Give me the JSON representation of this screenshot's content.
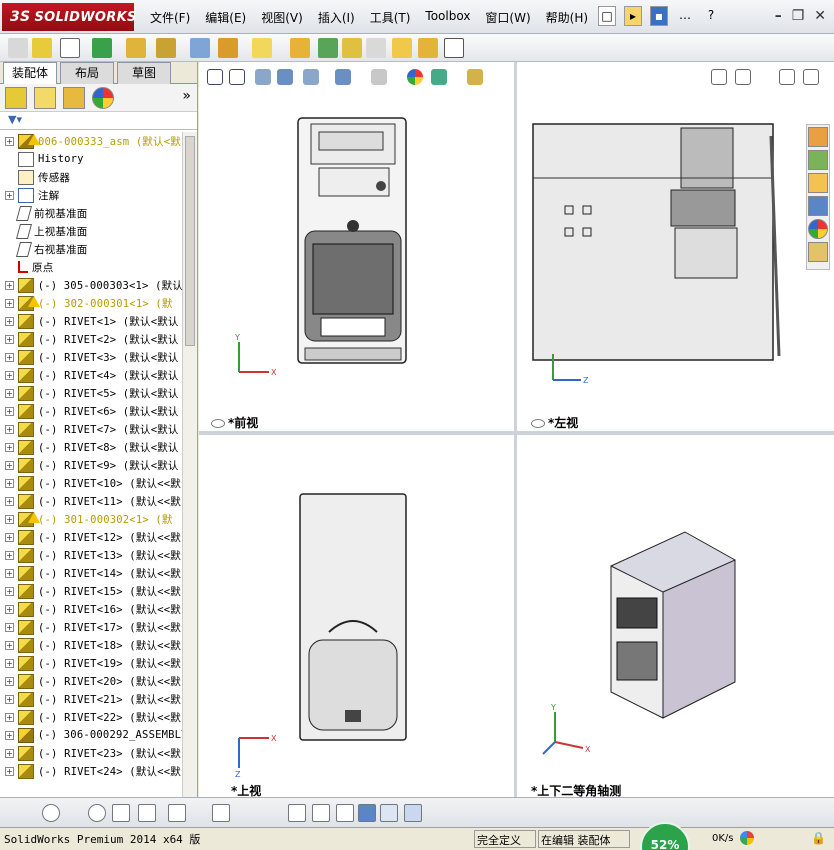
{
  "app": {
    "logo_ds": "3S",
    "logo_text": "SOLIDWORKS",
    "menu": [
      "文件(F)",
      "编辑(E)",
      "视图(V)",
      "插入(I)",
      "工具(T)",
      "Toolbox",
      "窗口(W)",
      "帮助(H)"
    ]
  },
  "panel": {
    "tabs": [
      "装配体",
      "布局",
      "草图"
    ],
    "expand_glyph": "»",
    "tree": [
      {
        "label": "006-000333_asm  (默认<默",
        "icon": "asm-warn",
        "exp": "+",
        "style": "warn"
      },
      {
        "label": "History",
        "icon": "hist",
        "exp": "",
        "style": "ok"
      },
      {
        "label": "传感器",
        "icon": "sens",
        "exp": "",
        "style": "ok"
      },
      {
        "label": "注解",
        "icon": "note",
        "exp": "+",
        "style": "ok"
      },
      {
        "label": "前视基准面",
        "icon": "plane",
        "exp": "",
        "style": "ok"
      },
      {
        "label": "上视基准面",
        "icon": "plane",
        "exp": "",
        "style": "ok"
      },
      {
        "label": "右视基准面",
        "icon": "plane",
        "exp": "",
        "style": "ok"
      },
      {
        "label": "原点",
        "icon": "origin",
        "exp": "",
        "style": "ok"
      },
      {
        "label": "(-) 305-000303<1> (默认",
        "icon": "part",
        "exp": "+",
        "style": "ok"
      },
      {
        "label": "(-) 302-000301<1> (默",
        "icon": "part-warn",
        "exp": "+",
        "style": "warn"
      },
      {
        "label": "(-) RIVET<1> (默认<默认",
        "icon": "part",
        "exp": "+",
        "style": "ok"
      },
      {
        "label": "(-) RIVET<2> (默认<默认",
        "icon": "part",
        "exp": "+",
        "style": "ok"
      },
      {
        "label": "(-) RIVET<3> (默认<默认",
        "icon": "part",
        "exp": "+",
        "style": "ok"
      },
      {
        "label": "(-) RIVET<4> (默认<默认",
        "icon": "part",
        "exp": "+",
        "style": "ok"
      },
      {
        "label": "(-) RIVET<5> (默认<默认",
        "icon": "part",
        "exp": "+",
        "style": "ok"
      },
      {
        "label": "(-) RIVET<6> (默认<默认",
        "icon": "part",
        "exp": "+",
        "style": "ok"
      },
      {
        "label": "(-) RIVET<7> (默认<默认",
        "icon": "part",
        "exp": "+",
        "style": "ok"
      },
      {
        "label": "(-) RIVET<8> (默认<默认",
        "icon": "part",
        "exp": "+",
        "style": "ok"
      },
      {
        "label": "(-) RIVET<9> (默认<默认",
        "icon": "part",
        "exp": "+",
        "style": "ok"
      },
      {
        "label": "(-) RIVET<10> (默认<<默",
        "icon": "part",
        "exp": "+",
        "style": "ok"
      },
      {
        "label": "(-) RIVET<11> (默认<<默",
        "icon": "part",
        "exp": "+",
        "style": "ok"
      },
      {
        "label": "(-) 301-000302<1> (默",
        "icon": "part-warn",
        "exp": "+",
        "style": "warn"
      },
      {
        "label": "(-) RIVET<12> (默认<<默",
        "icon": "part",
        "exp": "+",
        "style": "ok"
      },
      {
        "label": "(-) RIVET<13> (默认<<默",
        "icon": "part",
        "exp": "+",
        "style": "ok"
      },
      {
        "label": "(-) RIVET<14> (默认<<默",
        "icon": "part",
        "exp": "+",
        "style": "ok"
      },
      {
        "label": "(-) RIVET<15> (默认<<默",
        "icon": "part",
        "exp": "+",
        "style": "ok"
      },
      {
        "label": "(-) RIVET<16> (默认<<默",
        "icon": "part",
        "exp": "+",
        "style": "ok"
      },
      {
        "label": "(-) RIVET<17> (默认<<默",
        "icon": "part",
        "exp": "+",
        "style": "ok"
      },
      {
        "label": "(-) RIVET<18> (默认<<默",
        "icon": "part",
        "exp": "+",
        "style": "ok"
      },
      {
        "label": "(-) RIVET<19> (默认<<默",
        "icon": "part",
        "exp": "+",
        "style": "ok"
      },
      {
        "label": "(-) RIVET<20> (默认<<默",
        "icon": "part",
        "exp": "+",
        "style": "ok"
      },
      {
        "label": "(-) RIVET<21> (默认<<默",
        "icon": "part",
        "exp": "+",
        "style": "ok"
      },
      {
        "label": "(-) RIVET<22> (默认<<默",
        "icon": "part",
        "exp": "+",
        "style": "ok"
      },
      {
        "label": "(-) 306-000292_ASSEMBLY",
        "icon": "asm",
        "exp": "+",
        "style": "ok"
      },
      {
        "label": "(-) RIVET<23> (默认<<默",
        "icon": "part",
        "exp": "+",
        "style": "ok"
      },
      {
        "label": "(-) RIVET<24> (默认<<默",
        "icon": "part",
        "exp": "+",
        "style": "ok"
      }
    ]
  },
  "views": {
    "front": "*前视",
    "left": "*左视",
    "top": "*上视",
    "iso": "*上下二等角轴测"
  },
  "status": {
    "product": "SolidWorks Premium 2014 x64 版",
    "definition": "完全定义",
    "mode": "在编辑 装配体",
    "net_percent": "52%",
    "net_rate": "0K/s"
  }
}
